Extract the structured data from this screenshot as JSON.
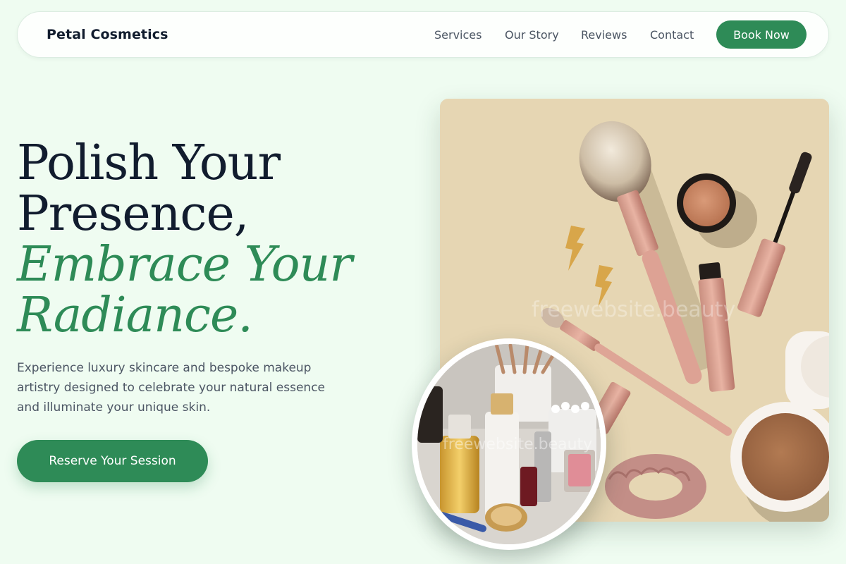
{
  "nav": {
    "brand": "Petal Cosmetics",
    "links": [
      "Services",
      "Our Story",
      "Reviews",
      "Contact"
    ],
    "cta_label": "Book Now"
  },
  "hero": {
    "headline_line1": "Polish Your",
    "headline_line2": "Presence,",
    "headline_accent_line1": "Embrace Your",
    "headline_accent_line2": "Radiance.",
    "subtext": "Experience luxury skincare and bespoke makeup artistry designed to celebrate your natural essence and illuminate your unique skin.",
    "cta_label": "Reserve Your Session",
    "watermark": "freewebsite.beauty"
  },
  "colors": {
    "accent": "#2e8b57",
    "background": "#effcf1",
    "heading": "#111c2e",
    "body_text": "#4b5563",
    "photo_backdrop": "#e6d6b3"
  }
}
